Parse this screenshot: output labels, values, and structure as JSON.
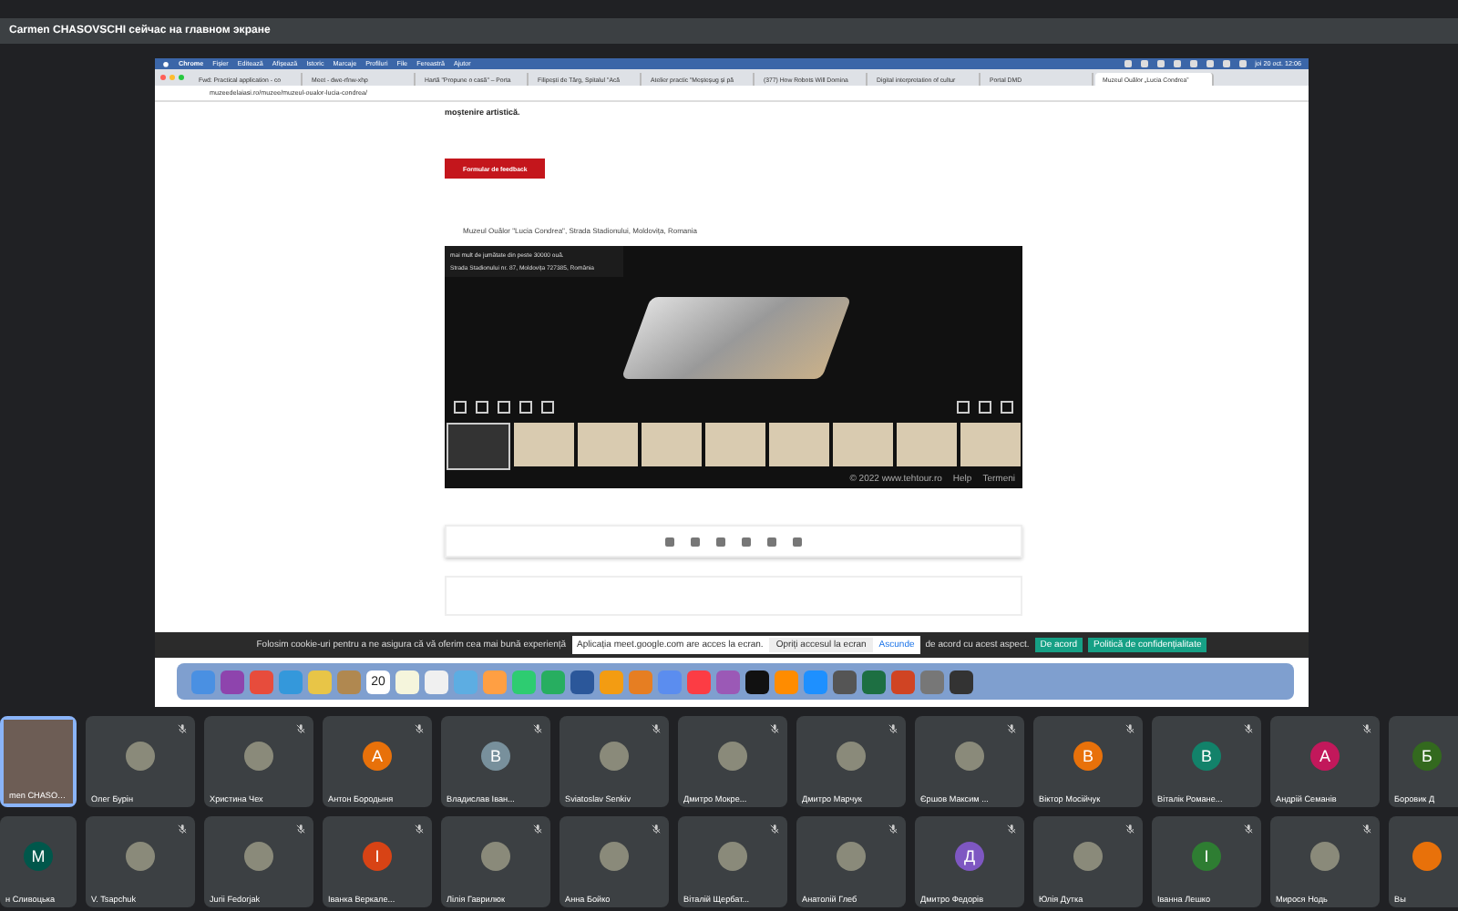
{
  "banner": {
    "text": "Carmen CHASOVSCHI сейчас на главном экране"
  },
  "screen": {
    "menubar": {
      "items": [
        "Chrome",
        "Fișier",
        "Editează",
        "Afișează",
        "Istoric",
        "Marcaje",
        "Profiluri",
        "File",
        "Fereastră",
        "Ajutor"
      ],
      "clock": "joi 20 oct. 12:06"
    },
    "tabs": [
      {
        "title": "Fwd: Practical application - co",
        "selected": false
      },
      {
        "title": "Meet - dwe-rfnw-xhp",
        "selected": false
      },
      {
        "title": "Hartă \"Propune o casă\" – Porta",
        "selected": false
      },
      {
        "title": "Filipești de Târg, Spitalul \"Acă",
        "selected": false
      },
      {
        "title": "Atelier practic \"Meșteșug și pă",
        "selected": false
      },
      {
        "title": "(377) How Robots Will Domina",
        "selected": false
      },
      {
        "title": "Digital interpretation of cultur",
        "selected": false
      },
      {
        "title": "Portal DMD",
        "selected": false
      },
      {
        "title": "Muzeul Ouălor „Lucia Condrea”",
        "selected": true
      }
    ],
    "url": "muzeedelaiasi.ro/muzee/muzeul-oualor-lucia-condrea/",
    "page": {
      "intro_tail": "moștenire artistică.",
      "feedback_button": "Formular de feedback",
      "caption": "Muzeul Ouălor \"Lucia Condrea\", Strada Stadionului, Moldovița, Romania",
      "viewer": {
        "info_lines": [
          "mai mult de jumătate din peste 30000 ouă.",
          "Strada Stadionului nr. 87, Moldovița 727385, România"
        ],
        "footer": [
          "© 2022 www.tehtour.ro",
          "Help",
          "Termeni"
        ]
      }
    },
    "cookie_bar": {
      "text": "Folosim cookie-uri pentru a ne asigura că vă oferim cea mai bună experiență",
      "text_tail": "de acord cu acest aspect.",
      "accept": "De acord",
      "policy": "Politică de confidențialitate"
    },
    "share_popup": {
      "text": "Aplicația meet.google.com are acces la ecran.",
      "stop": "Opriți accesul la ecran",
      "hide": "Ascunde"
    },
    "dock": {
      "calendar_day": "20"
    }
  },
  "participants": [
    [
      {
        "name": "men CHASO…",
        "kind": "video",
        "muted": false,
        "selected": true
      },
      {
        "name": "Олег Бурін",
        "kind": "photo",
        "muted": true,
        "selected": false
      },
      {
        "name": "Христина Чех",
        "kind": "photo",
        "muted": true,
        "selected": false
      },
      {
        "name": "Антон Бородыня",
        "kind": "letter",
        "letter": "А",
        "color": "#e8710a",
        "muted": true,
        "selected": false
      },
      {
        "name": "Владислав Іван...",
        "kind": "letter",
        "letter": "В",
        "color": "#78909c",
        "muted": true,
        "selected": false
      },
      {
        "name": "Sviatoslav Senkiv",
        "kind": "photo",
        "muted": true,
        "selected": false
      },
      {
        "name": "Дмитро Мокре...",
        "kind": "photo",
        "muted": true,
        "selected": false
      },
      {
        "name": "Дмитро Марчук",
        "kind": "photo",
        "muted": true,
        "selected": false
      },
      {
        "name": "Єршов Максим ...",
        "kind": "photo",
        "muted": true,
        "selected": false
      },
      {
        "name": "Віктор Мосійчук",
        "kind": "letter",
        "letter": "В",
        "color": "#e8710a",
        "muted": true,
        "selected": false
      },
      {
        "name": "Віталік Романе...",
        "kind": "letter",
        "letter": "В",
        "color": "#12826a",
        "muted": true,
        "selected": false
      },
      {
        "name": "Андрій Семанів",
        "kind": "letter",
        "letter": "А",
        "color": "#c2185b",
        "muted": true,
        "selected": false
      },
      {
        "name": "Боровик Д",
        "kind": "letter",
        "letter": "Б",
        "color": "#33691e",
        "muted": false,
        "selected": false
      }
    ],
    [
      {
        "name": "н Сливоцька",
        "kind": "letter",
        "letter": "М",
        "color": "#00574b",
        "muted": false,
        "selected": false
      },
      {
        "name": "V. Tsapchuk",
        "kind": "photo",
        "muted": true,
        "selected": false
      },
      {
        "name": "Jurii Fedorjak",
        "kind": "photo",
        "muted": true,
        "selected": false
      },
      {
        "name": "Іванка Веркале...",
        "kind": "letter",
        "letter": "І",
        "color": "#d84315",
        "muted": true,
        "selected": false
      },
      {
        "name": "Лілія Гаврилюк",
        "kind": "photo",
        "muted": true,
        "selected": false
      },
      {
        "name": "Анна Бойко",
        "kind": "photo",
        "muted": true,
        "selected": false
      },
      {
        "name": "Віталій Щербат...",
        "kind": "photo",
        "muted": true,
        "selected": false
      },
      {
        "name": "Анатолій Глеб",
        "kind": "photo",
        "muted": true,
        "selected": false
      },
      {
        "name": "Дмитро Федорів",
        "kind": "letter",
        "letter": "Д",
        "color": "#7e57c2",
        "muted": true,
        "selected": false
      },
      {
        "name": "Юлія Дутка",
        "kind": "photo",
        "muted": true,
        "selected": false
      },
      {
        "name": "Іванна Лешко",
        "kind": "letter",
        "letter": "І",
        "color": "#2e7d32",
        "muted": true,
        "selected": false
      },
      {
        "name": "Мирося Нодь",
        "kind": "photo",
        "muted": true,
        "selected": false
      },
      {
        "name": "Вы",
        "kind": "letter",
        "color": "#e8710a",
        "muted": false,
        "selected": false
      }
    ]
  ]
}
